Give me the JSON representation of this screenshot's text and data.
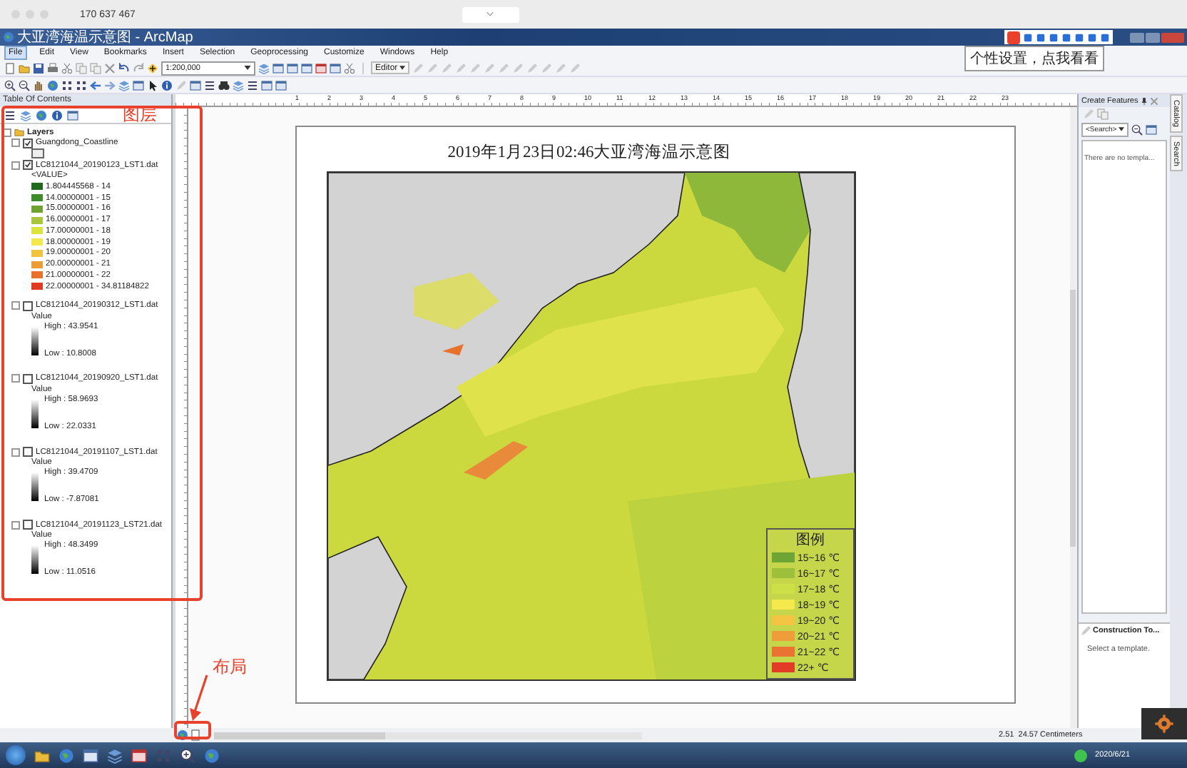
{
  "browser": {
    "title": "170 637 467"
  },
  "window": {
    "title": "大亚湾海温示意图 - ArcMap"
  },
  "ime_tooltip": "个性设置，点我看看",
  "menu": [
    {
      "label": "File",
      "selected": true
    },
    {
      "label": "Edit",
      "selected": false
    },
    {
      "label": "View",
      "selected": false
    },
    {
      "label": "Bookmarks",
      "selected": false
    },
    {
      "label": "Insert",
      "selected": false
    },
    {
      "label": "Selection",
      "selected": false
    },
    {
      "label": "Geoprocessing",
      "selected": false
    },
    {
      "label": "Customize",
      "selected": false
    },
    {
      "label": "Windows",
      "selected": false
    },
    {
      "label": "Help",
      "selected": false
    }
  ],
  "toolbar": {
    "scale": "1:200,000",
    "editor": "Editor"
  },
  "toc": {
    "title": "Table Of Contents",
    "root": "Layers",
    "layers": [
      {
        "kind": "vector",
        "name": "Guangdong_Coastline",
        "checked": true
      },
      {
        "kind": "classified",
        "name": "LC8121044_20190123_LST1.dat",
        "checked": true,
        "field": "<VALUE>",
        "classes": [
          {
            "label": "1.804445568 - 14",
            "color": "#1f6a1f"
          },
          {
            "label": "14.00000001 - 15",
            "color": "#3f8a2a"
          },
          {
            "label": "15.00000001 - 16",
            "color": "#6ea332"
          },
          {
            "label": "16.00000001 - 17",
            "color": "#a9c53c"
          },
          {
            "label": "17.00000001 - 18",
            "color": "#dbe43c"
          },
          {
            "label": "18.00000001 - 19",
            "color": "#f3e94c"
          },
          {
            "label": "19.00000001 - 20",
            "color": "#f2c43e"
          },
          {
            "label": "20.00000001 - 21",
            "color": "#ee9c36"
          },
          {
            "label": "21.00000001 - 22",
            "color": "#e8722c"
          },
          {
            "label": "22.00000001 - 34.81184822",
            "color": "#e03a22"
          }
        ]
      },
      {
        "kind": "stretched",
        "name": "LC8121044_20190312_LST1.dat",
        "checked": false,
        "field": "Value",
        "high": "High : 43.9541",
        "low": "Low : 10.8008"
      },
      {
        "kind": "stretched",
        "name": "LC8121044_20190920_LST1.dat",
        "checked": false,
        "field": "Value",
        "high": "High : 58.9693",
        "low": "Low : 22.0331"
      },
      {
        "kind": "stretched",
        "name": "LC8121044_20191107_LST1.dat",
        "checked": false,
        "field": "Value",
        "high": "High : 39.4709",
        "low": "Low : -7.87081"
      },
      {
        "kind": "stretched",
        "name": "LC8121044_20191123_LST21.dat",
        "checked": false,
        "field": "Value",
        "high": "High : 48.3499",
        "low": "Low : 11.0516"
      }
    ]
  },
  "annotations": {
    "toc_label": "图层",
    "layout_label": "布局"
  },
  "ruler_marks": [
    "1",
    "2",
    "3",
    "4",
    "5",
    "6",
    "7",
    "8",
    "9",
    "10",
    "11",
    "12",
    "13",
    "14",
    "15",
    "16",
    "17",
    "18",
    "19",
    "20",
    "21",
    "22",
    "23"
  ],
  "layout": {
    "title": "2019年1月23日02:46大亚湾海温示意图",
    "legend": {
      "title": "图例",
      "items": [
        {
          "label": "15~16 ℃",
          "color": "#6ea535"
        },
        {
          "label": "16~17 ℃",
          "color": "#9cbf3c"
        },
        {
          "label": "17~18 ℃",
          "color": "#cde048"
        },
        {
          "label": "18~19 ℃",
          "color": "#f5e84d"
        },
        {
          "label": "19~20 ℃",
          "color": "#f3c443"
        },
        {
          "label": "20~21 ℃",
          "color": "#ef9d3b"
        },
        {
          "label": "21~22 ℃",
          "color": "#ea7332"
        },
        {
          "label": "22+ ℃",
          "color": "#e23b26"
        }
      ]
    }
  },
  "status_bar": "2.51  24.57 Centimeters",
  "create_features": {
    "title": "Create Features",
    "search_placeholder": "<Search>",
    "empty_text": "There are no templa..."
  },
  "construction_tools": {
    "title": "Construction To...",
    "hint": "Select a template."
  },
  "side_tabs": [
    "Catalog",
    "Search"
  ],
  "taskbar": {
    "date": "2020/6/21"
  }
}
